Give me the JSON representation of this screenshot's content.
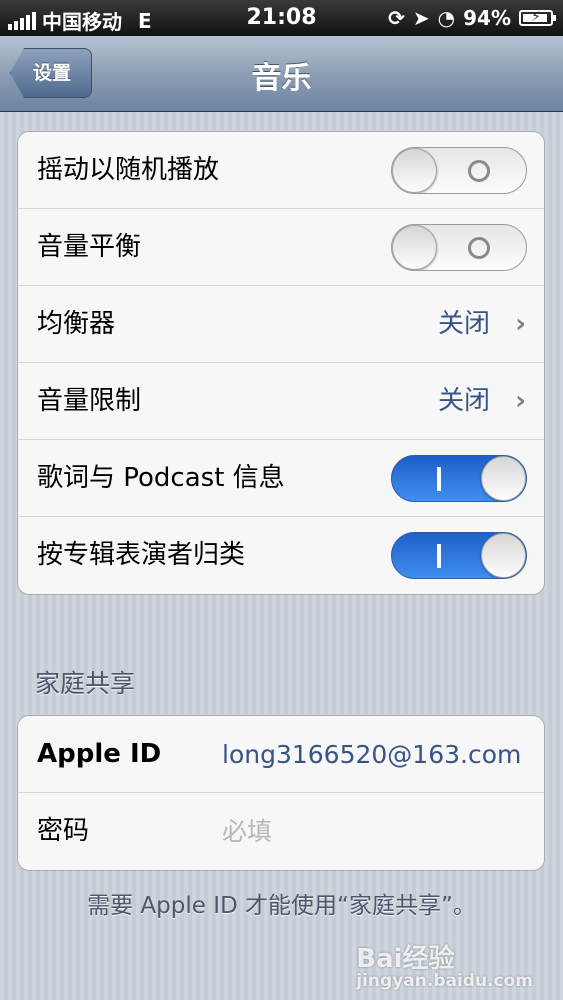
{
  "status_bar": {
    "carrier": "中国移动",
    "network": "E",
    "time": "21:08",
    "battery": "94%",
    "battery_level": 0.94
  },
  "nav": {
    "back_label": "设置",
    "title": "音乐"
  },
  "settings": [
    {
      "label": "摇动以随机播放",
      "type": "switch",
      "on": false
    },
    {
      "label": "音量平衡",
      "type": "switch",
      "on": false
    },
    {
      "label": "均衡器",
      "type": "disclosure",
      "value": "关闭"
    },
    {
      "label": "音量限制",
      "type": "disclosure",
      "value": "关闭"
    },
    {
      "label": "歌词与 Podcast 信息",
      "type": "switch",
      "on": true
    },
    {
      "label": "按专辑表演者归类",
      "type": "switch",
      "on": true
    }
  ],
  "home_sharing": {
    "header": "家庭共享",
    "apple_id_label": "Apple ID",
    "apple_id_value": "long3166520@163.com",
    "password_label": "密码",
    "password_placeholder": "必填",
    "footer": "需要 Apple ID 才能使用“家庭共享”。"
  },
  "watermark": {
    "text": "Bai经验",
    "url": "jingyan.baidu.com"
  },
  "colors": {
    "switch_on": "#2a74e0",
    "value_text": "#385487",
    "background": "#c5ccd4"
  }
}
